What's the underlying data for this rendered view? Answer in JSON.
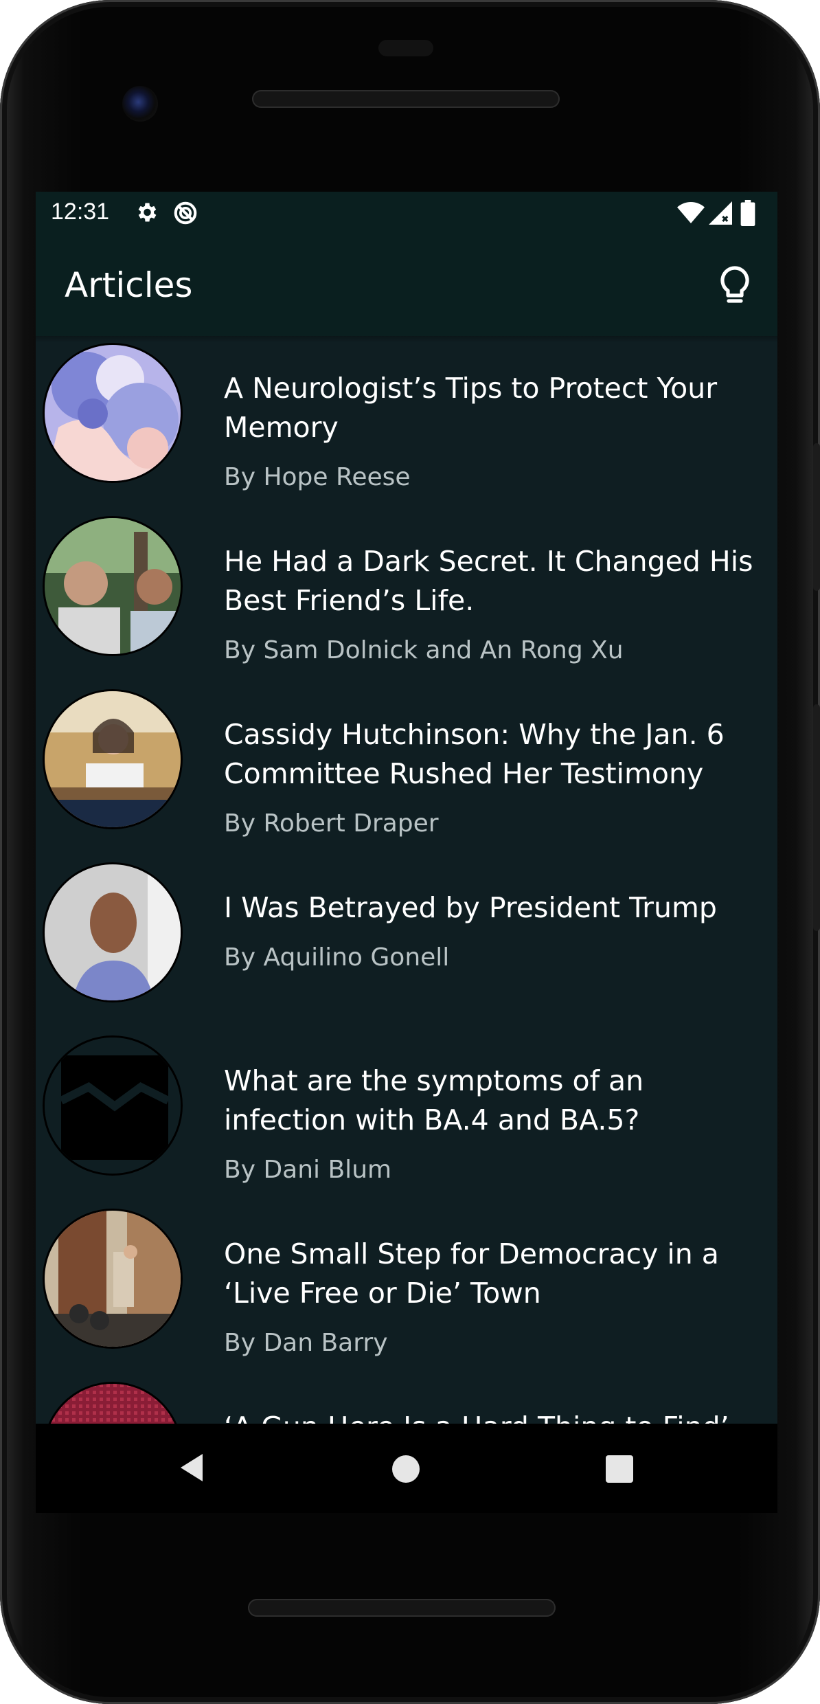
{
  "status_bar": {
    "time": "12:31",
    "left_icons": [
      "gear-icon",
      "do-not-disturb-icon"
    ],
    "right_icons": [
      "wifi-icon",
      "cell-signal-icon",
      "battery-icon"
    ]
  },
  "app_bar": {
    "title": "Articles",
    "action_icon": "lightbulb-icon"
  },
  "articles": [
    {
      "title": "A Neurologist’s Tips to Protect Your Memory",
      "byline": "By Hope Reese"
    },
    {
      "title": "He Had a Dark Secret. It Changed His Best Friend’s Life.",
      "byline": "By Sam Dolnick and An Rong Xu"
    },
    {
      "title": "Cassidy Hutchinson: Why the Jan. 6 Committee Rushed Her Testimony",
      "byline": "By Robert Draper"
    },
    {
      "title": "I Was Betrayed by President Trump",
      "byline": "By Aquilino Gonell"
    },
    {
      "title": "What are the symptoms of an infection with BA.4 and BA.5?",
      "byline": "By Dani Blum"
    },
    {
      "title": "One Small Step for Democracy in a ‘Live Free or Die’ Town",
      "byline": "By Dan Barry"
    },
    {
      "title": "‘A Gun Here Is a Hard Thing to Find’",
      "byline": ""
    }
  ],
  "nav_bar": {
    "icons": [
      "back-icon",
      "home-icon",
      "recents-icon"
    ]
  },
  "colors": {
    "background": "#0f1e22",
    "app_bar": "#0a1f1f",
    "title_text": "#ffffff",
    "byline_text": "#b9c3c5"
  }
}
